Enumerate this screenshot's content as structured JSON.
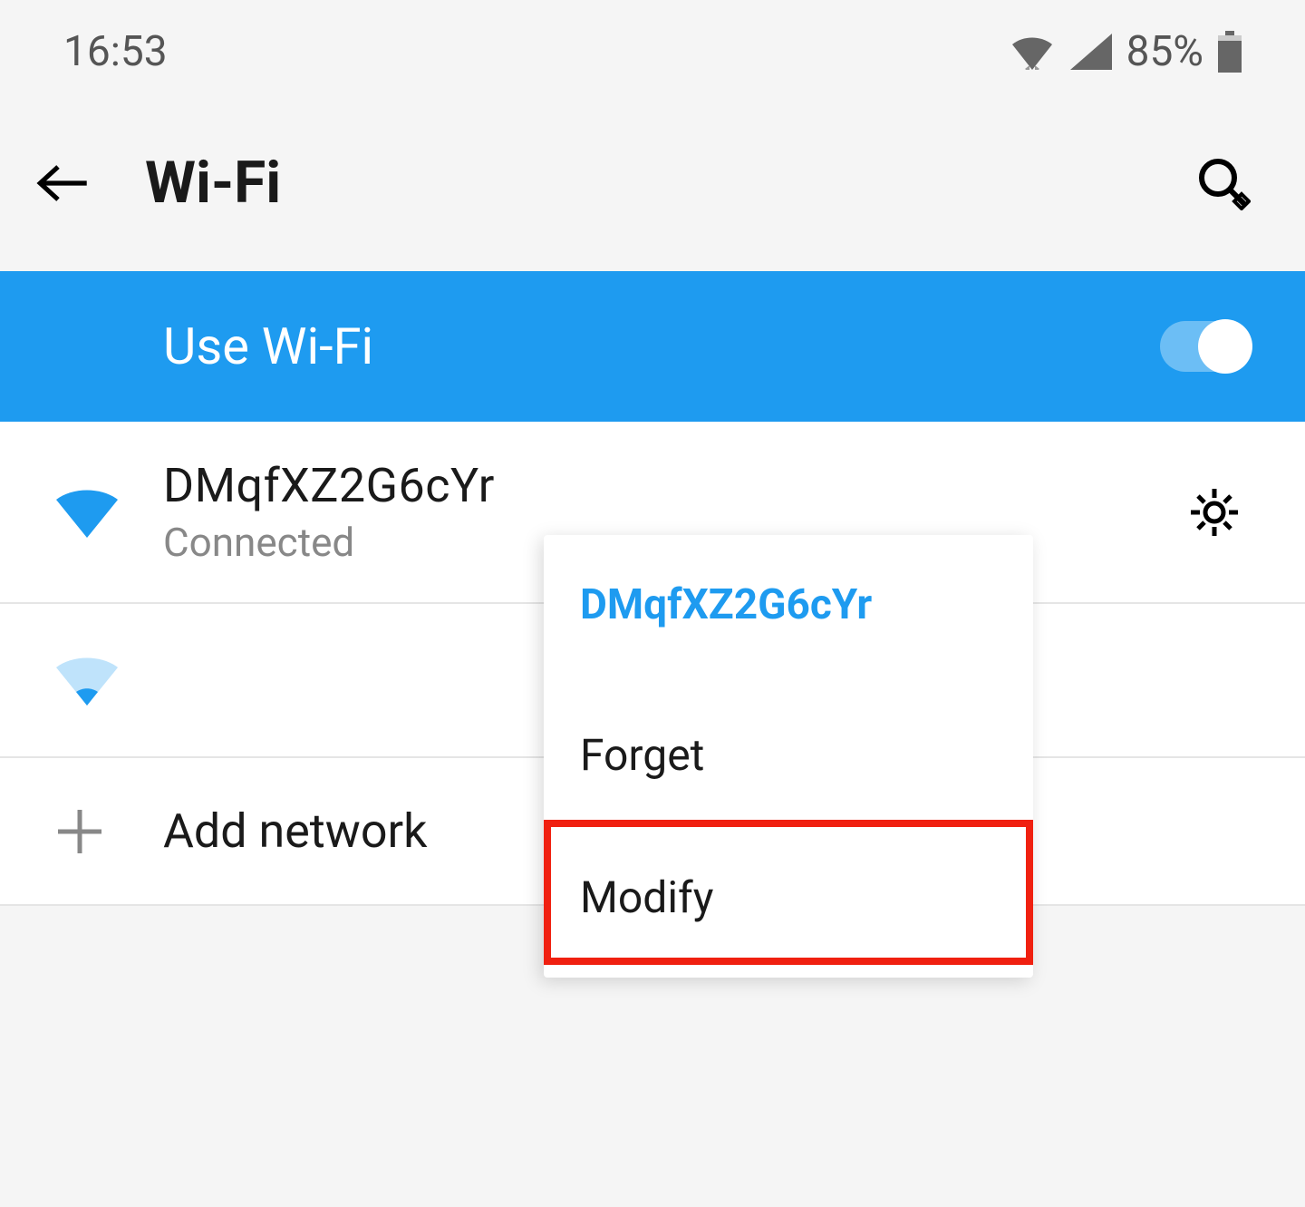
{
  "statusBar": {
    "time": "16:53",
    "battery": "85%"
  },
  "header": {
    "title": "Wi-Fi"
  },
  "wifiToggle": {
    "label": "Use Wi-Fi",
    "on": true
  },
  "networks": [
    {
      "name": "DMqfXZ2G6cYr",
      "status": "Connected",
      "signal": "full"
    },
    {
      "name": "",
      "status": "",
      "signal": "weak"
    }
  ],
  "addNetwork": {
    "label": "Add network"
  },
  "contextMenu": {
    "title": "DMqfXZ2G6cYr",
    "items": [
      {
        "label": "Forget"
      },
      {
        "label": "Modify"
      }
    ],
    "highlightedIndex": 1
  }
}
